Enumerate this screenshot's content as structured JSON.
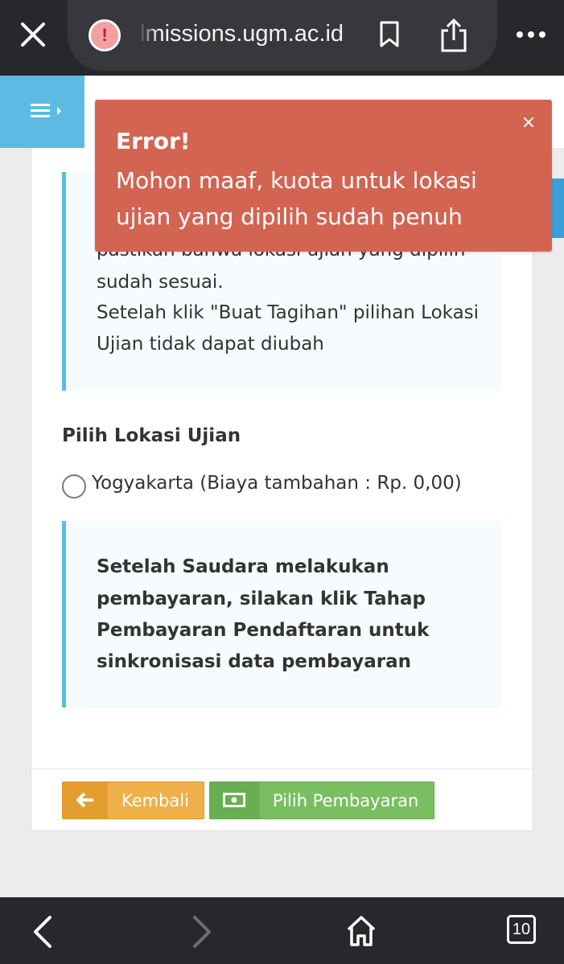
{
  "browser": {
    "url": "lmissions.ugm.ac.id",
    "tab_count": "10"
  },
  "callout_top": {
    "lines": [
      "pastikan bahwa lokasi ujian yang dipilih",
      "sudah sesuai.",
      "Setelah klik \"Buat Tagihan\" pilihan Lokasi",
      "Ujian tidak dapat diubah"
    ]
  },
  "location": {
    "label": "Pilih Lokasi Ujian",
    "option": "Yogyakarta (Biaya tambahan : Rp. 0,00)",
    "selected": false
  },
  "callout_bottom": {
    "lines": [
      "Setelah Saudara melakukan",
      "pembayaran, silakan klik Tahap",
      "Pembayaran Pendaftaran untuk",
      "sinkronisasi data pembayaran"
    ]
  },
  "buttons": {
    "back": "Kembali",
    "pay": "Pilih Pembayaran"
  },
  "toast": {
    "title": "Error!",
    "message": "Mohon maaf, kuota untuk lokasi ujian yang dipilih sudah penuh",
    "close": "×"
  },
  "colors": {
    "accent": "#5dbbe3",
    "error": "#d36452",
    "back_button": "#efb04a",
    "pay_button": "#79bf62"
  }
}
